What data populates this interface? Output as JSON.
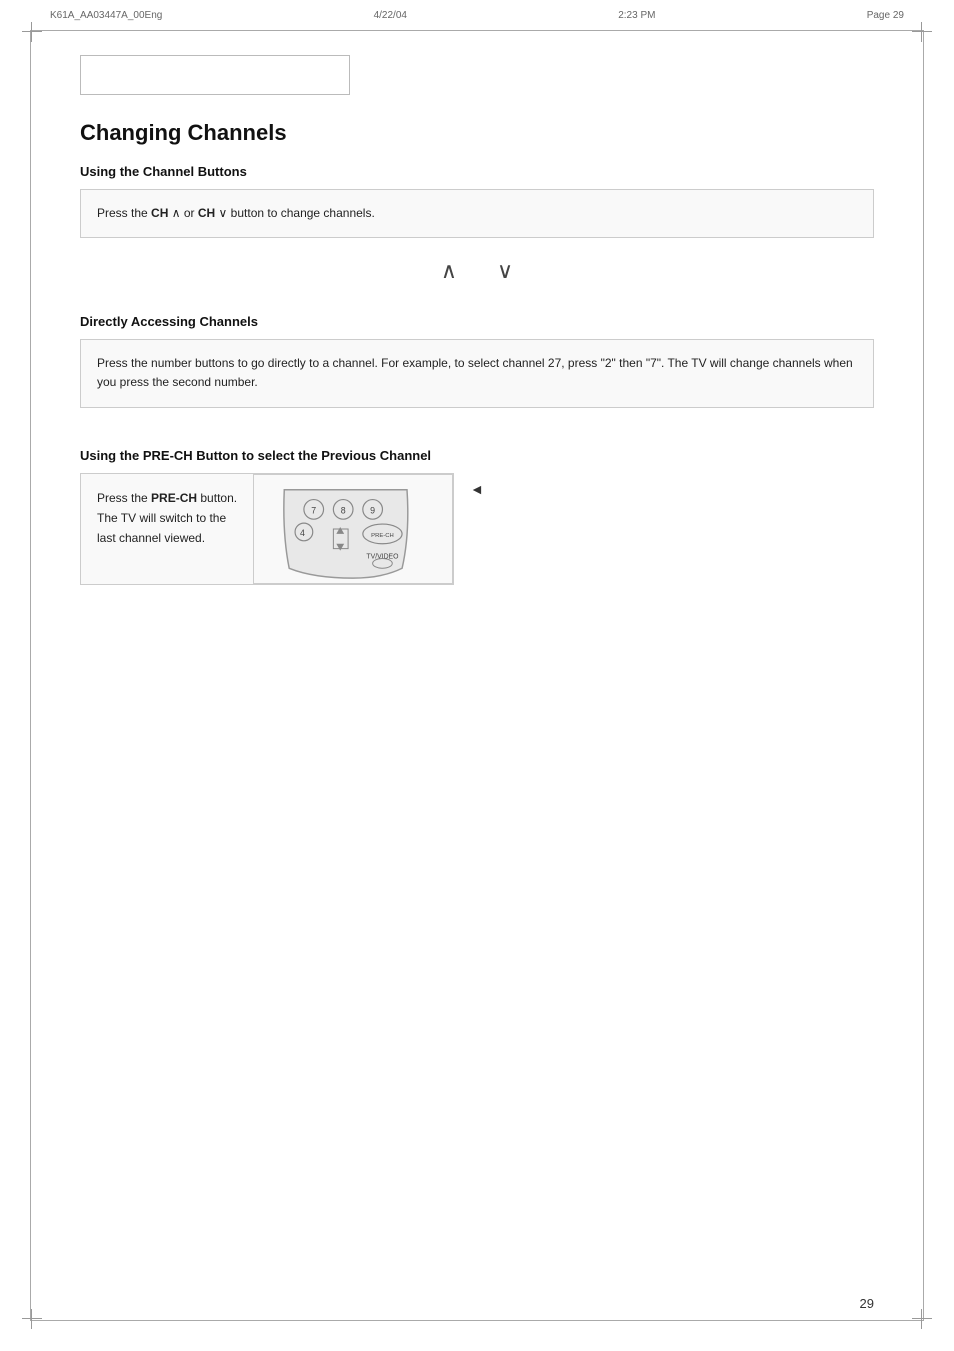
{
  "header": {
    "file_info": "K61A_AA03447A_00Eng",
    "date": "4/22/04",
    "time": "2:23 PM",
    "page_label": "Page 29"
  },
  "page_title": "Changing Channels",
  "sections": {
    "using_channel_buttons": {
      "heading": "Using the Channel Buttons",
      "instruction": "Press the ",
      "ch_up": "CH",
      "or_text": " or ",
      "ch_down": "CH",
      "button_suffix": " button to change channels."
    },
    "directly_accessing": {
      "heading": "Directly Accessing Channels",
      "description": "Press the number buttons to go directly to a channel. For example, to select channel 27, press \"2\" then \"7\". The TV will change channels when you press the second number."
    },
    "prech": {
      "heading": "Using the PRE-CH Button to select the Previous Channel",
      "line1": "Press the ",
      "bold_label": "PRE-CH",
      "line2": " button.",
      "line3": "The TV will switch to the",
      "line4": "last channel viewed."
    }
  },
  "page_number": "29"
}
